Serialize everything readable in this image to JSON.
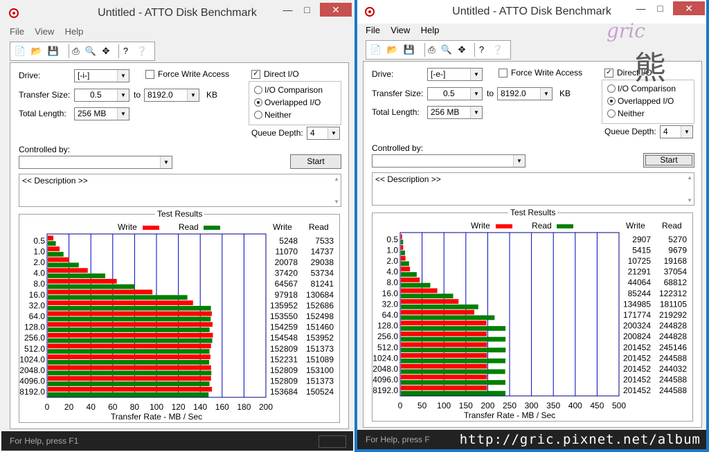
{
  "windows": [
    {
      "title": "Untitled - ATTO Disk Benchmark",
      "menu": [
        "File",
        "View",
        "Help"
      ],
      "drive_label": "Drive:",
      "drive_value": "[-i-]",
      "force_write_access": "Force Write Access",
      "force_checked": false,
      "direct_io": "Direct I/O",
      "direct_checked": true,
      "transfer_size_label": "Transfer Size:",
      "transfer_from": "0.5",
      "to_label": "to",
      "transfer_to": "8192.0",
      "kb_label": "KB",
      "total_length_label": "Total Length:",
      "total_length": "256 MB",
      "io_comparison": "I/O Comparison",
      "overlapped_io": "Overlapped I/O",
      "neither": "Neither",
      "queue_depth_label": "Queue Depth:",
      "queue_depth": "4",
      "controlled_by_label": "Controlled by:",
      "controlled_by_value": "",
      "start_label": "Start",
      "description": "<< Description >>",
      "results_title": "Test Results",
      "write_label": "Write",
      "read_label": "Read",
      "col_write": "Write",
      "col_read": "Read",
      "xlabel": "Transfer Rate - MB / Sec",
      "status": "For Help, press F1"
    },
    {
      "title": "Untitled - ATTO Disk Benchmark",
      "menu": [
        "File",
        "View",
        "Help"
      ],
      "drive_label": "Drive:",
      "drive_value": "[-e-]",
      "force_write_access": "Force Write Access",
      "force_checked": false,
      "direct_io": "Direct I/O",
      "direct_checked": true,
      "transfer_size_label": "Transfer Size:",
      "transfer_from": "0.5",
      "to_label": "to",
      "transfer_to": "8192.0",
      "kb_label": "KB",
      "total_length_label": "Total Length:",
      "total_length": "256 MB",
      "io_comparison": "I/O Comparison",
      "overlapped_io": "Overlapped I/O",
      "neither": "Neither",
      "queue_depth_label": "Queue Depth:",
      "queue_depth": "4",
      "controlled_by_label": "Controlled by:",
      "controlled_by_value": "",
      "start_label": "Start",
      "description": "<< Description >>",
      "results_title": "Test Results",
      "write_label": "Write",
      "read_label": "Read",
      "col_write": "Write",
      "col_read": "Read",
      "xlabel": "Transfer Rate - MB / Sec",
      "status": "For Help, press F"
    }
  ],
  "chart_data": [
    {
      "type": "bar",
      "orientation": "horizontal",
      "xlabel": "Transfer Rate - MB / Sec",
      "xlim": [
        0,
        200
      ],
      "xticks": [
        "0",
        "20",
        "40",
        "60",
        "80",
        "100",
        "120",
        "140",
        "160",
        "180",
        "200"
      ],
      "categories": [
        "0.5",
        "1.0",
        "2.0",
        "4.0",
        "8.0",
        "16.0",
        "32.0",
        "64.0",
        "128.0",
        "256.0",
        "512.0",
        "1024.0",
        "2048.0",
        "4096.0",
        "8192.0"
      ],
      "series": [
        {
          "name": "Write",
          "color": "#ff0000",
          "values": [
            5248,
            11070,
            20078,
            37420,
            64567,
            97918,
            135952,
            153550,
            154259,
            154548,
            152809,
            152231,
            152809,
            152809,
            153684
          ]
        },
        {
          "name": "Read",
          "color": "#008000",
          "values": [
            7533,
            14737,
            29038,
            53734,
            81241,
            130684,
            152686,
            152498,
            151460,
            153952,
            151373,
            151089,
            153100,
            151373,
            150524
          ]
        }
      ]
    },
    {
      "type": "bar",
      "orientation": "horizontal",
      "xlabel": "Transfer Rate - MB / Sec",
      "xlim": [
        0,
        500
      ],
      "xticks": [
        "0",
        "50",
        "100",
        "150",
        "200",
        "250",
        "300",
        "350",
        "400",
        "450",
        "500"
      ],
      "categories": [
        "0.5",
        "1.0",
        "2.0",
        "4.0",
        "8.0",
        "16.0",
        "32.0",
        "64.0",
        "128.0",
        "256.0",
        "512.0",
        "1024.0",
        "2048.0",
        "4096.0",
        "8192.0"
      ],
      "series": [
        {
          "name": "Write",
          "color": "#ff0000",
          "values": [
            2907,
            5415,
            10725,
            21291,
            44064,
            85244,
            134985,
            171774,
            200324,
            200824,
            201452,
            201452,
            201452,
            201452,
            201452
          ]
        },
        {
          "name": "Read",
          "color": "#008000",
          "values": [
            5270,
            9679,
            19168,
            37054,
            68812,
            122312,
            181105,
            219292,
            244828,
            244828,
            245146,
            244588,
            244032,
            244588,
            244588
          ]
        }
      ]
    }
  ],
  "watermark": {
    "url": "http://gric.pixnet.net/album",
    "logo_text": "gric",
    "logo_char": "熊"
  }
}
